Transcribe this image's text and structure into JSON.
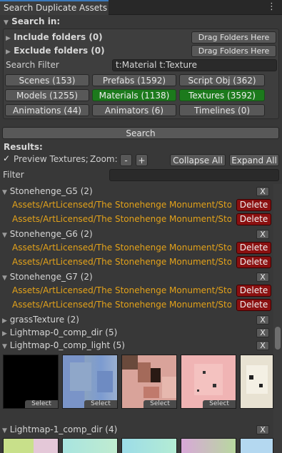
{
  "window": {
    "tab_title": "Search Duplicate Assets"
  },
  "search_in": {
    "header": "Search in:",
    "include_folders": "Include folders (0)",
    "exclude_folders": "Exclude folders (0)",
    "drag_label": "Drag Folders Here",
    "filter_label": "Search Filter",
    "filter_value": "t:Material t:Texture",
    "types": [
      {
        "label": "Scenes (153)",
        "active": false
      },
      {
        "label": "Prefabs (1592)",
        "active": false
      },
      {
        "label": "Script Obj (362)",
        "active": false
      },
      {
        "label": "Models (1255)",
        "active": false
      },
      {
        "label": "Materials (1138)",
        "active": true
      },
      {
        "label": "Textures (3592)",
        "active": true
      },
      {
        "label": "Animations (44)",
        "active": false
      },
      {
        "label": "Animators (6)",
        "active": false
      },
      {
        "label": "Timelines (0)",
        "active": false
      }
    ]
  },
  "search_button": "Search",
  "results": {
    "header": "Results:",
    "preview_label": "Preview Textures;",
    "preview_checked": true,
    "zoom_label": "Zoom:",
    "zoom_minus": "-",
    "zoom_plus": "+",
    "collapse_all": "Collapse All",
    "expand_all": "Expand All",
    "filter_label": "Filter",
    "filter_value": "",
    "remove_label": "X",
    "delete_label": "Delete",
    "select_label": "Select",
    "groups": [
      {
        "name": "Stonehenge_G5 (2)",
        "paths": [
          "Assets/ArtLicensed/The Stonehenge Monument/Stone",
          "Assets/ArtLicensed/The Stonehenge Monument/Stone"
        ]
      },
      {
        "name": "Stonehenge_G6 (2)",
        "paths": [
          "Assets/ArtLicensed/The Stonehenge Monument/Stone",
          "Assets/ArtLicensed/The Stonehenge Monument/Stone"
        ]
      },
      {
        "name": "Stonehenge_G7 (2)",
        "paths": [
          "Assets/ArtLicensed/The Stonehenge Monument/Stone",
          "Assets/ArtLicensed/The Stonehenge Monument/Stone"
        ]
      },
      {
        "name": "grassTexture (2)",
        "paths": []
      },
      {
        "name": "Lightmap-0_comp_dir (5)",
        "paths": []
      },
      {
        "name": "Lightmap-0_comp_light (5)",
        "paths": []
      },
      {
        "name": "Lightmap-1_comp_dir (4)",
        "paths": []
      }
    ]
  }
}
